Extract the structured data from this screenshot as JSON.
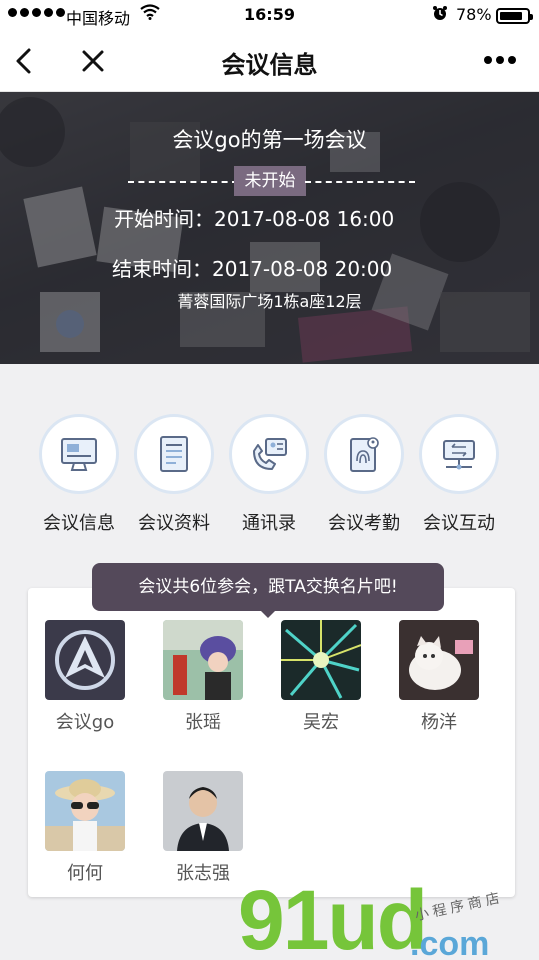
{
  "status_bar": {
    "carrier": "中国移动",
    "time": "16:59",
    "battery": "78%"
  },
  "nav": {
    "title": "会议信息"
  },
  "banner": {
    "meeting_title": "会议go的第一场会议",
    "status": "未开始",
    "start_label": "开始时间：",
    "start_value": "2017-08-08 16:00",
    "end_label": "结束时间：",
    "end_value": "2017-08-08 20:00",
    "address": "菁蓉国际广场1栋a座12层"
  },
  "menu": {
    "items": [
      {
        "label": "会议信息",
        "icon": "monitor-icon"
      },
      {
        "label": "会议资料",
        "icon": "document-icon"
      },
      {
        "label": "通讯录",
        "icon": "phone-contact-icon"
      },
      {
        "label": "会议考勤",
        "icon": "fingerprint-icon"
      },
      {
        "label": "会议互动",
        "icon": "network-icon"
      }
    ]
  },
  "participants": {
    "tip": "会议共6位参会，跟TA交换名片吧!",
    "people": [
      {
        "name": "会议go"
      },
      {
        "name": "张瑶"
      },
      {
        "name": "吴宏"
      },
      {
        "name": "杨洋"
      },
      {
        "name": "何何"
      },
      {
        "name": "张志强"
      }
    ]
  },
  "watermark": {
    "brand": "91ud",
    "domain": ".com",
    "tagline": "小程序商店"
  },
  "colors": {
    "badge": "#7a6a80",
    "tooltip": "#54495a",
    "icon_ring": "#dbe6f3",
    "watermark_green": "#76c53a",
    "watermark_blue": "#5aa7d8"
  }
}
